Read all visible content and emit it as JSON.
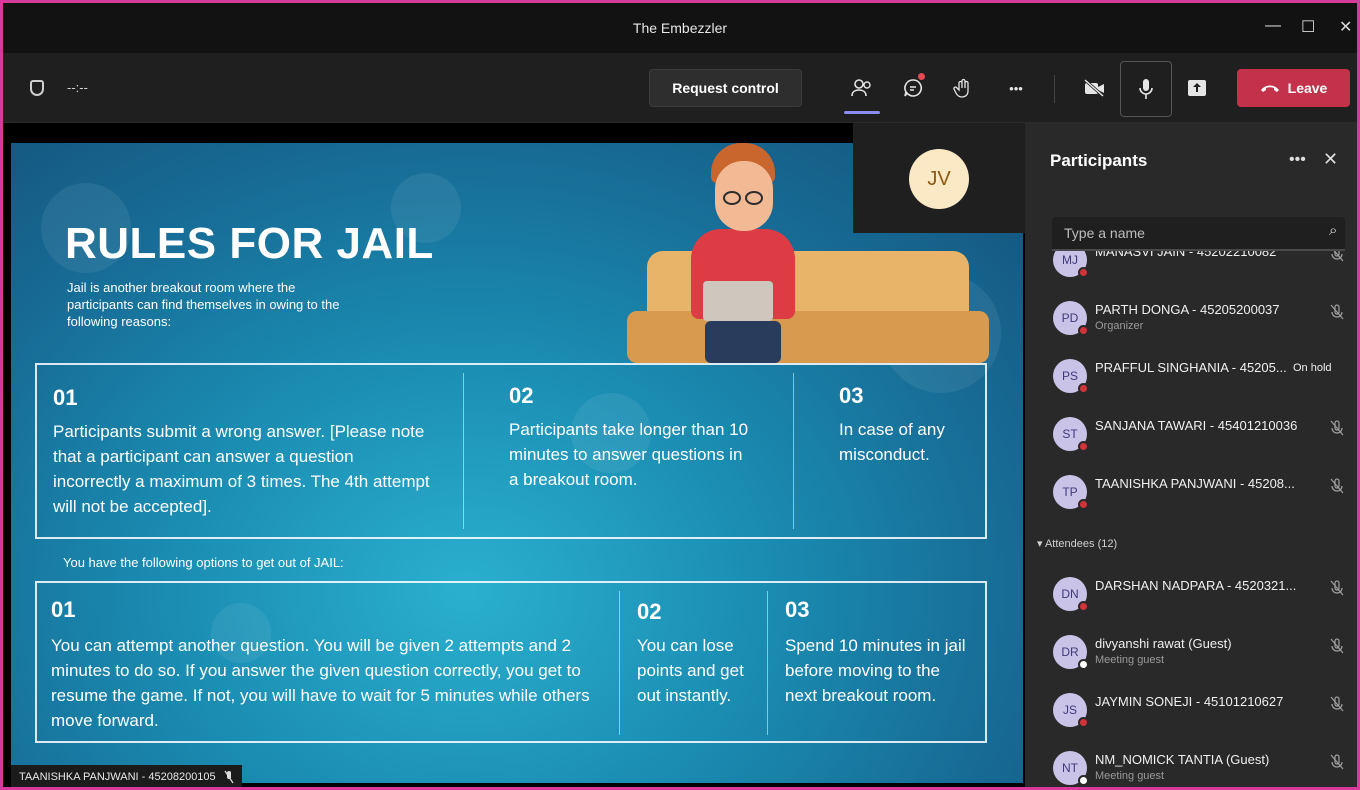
{
  "window": {
    "title": "The Embezzler",
    "minimize": "—",
    "maximize": "☐",
    "close": "✕"
  },
  "toolbar": {
    "timer": "--:--",
    "request_control": "Request control",
    "more": "•••",
    "leave": "Leave",
    "accent_color": "#c4314b"
  },
  "slide": {
    "title": "RULES FOR JAIL",
    "intro": "Jail is another breakout room where the participants can find themselves in owing to the following reasons:",
    "reasons": [
      {
        "num": "01",
        "text": "Participants submit a wrong answer. [Please note that a participant can answer a question incorrectly a maximum of 3 times. The 4th attempt will not be accepted]."
      },
      {
        "num": "02",
        "text": "Participants take longer than 10 minutes to answer questions in a breakout room."
      },
      {
        "num": "03",
        "text": "In case of any misconduct."
      }
    ],
    "options_label": "You have the following options to get out of JAIL:",
    "options": [
      {
        "num": "01",
        "text": "You can attempt another question. You will be given 2 attempts and 2 minutes to do so. If you answer the given question correctly, you get to resume the game. If not, you will have to wait for 5 minutes while others move forward."
      },
      {
        "num": "02",
        "text": "You can lose points and get out instantly."
      },
      {
        "num": "03",
        "text": "Spend 10 minutes in jail before moving to the next breakout room."
      }
    ]
  },
  "self_tile": {
    "initials": "JV"
  },
  "presenter": {
    "name": "TAANISHKA PANJWANI - 45208200105"
  },
  "participants_panel": {
    "title": "Participants",
    "more": "•••",
    "close": "✕",
    "search_placeholder": "Type a name",
    "presenters": [
      {
        "initials": "MJ",
        "name": "MANASVI JAIN - 45202210082",
        "role": "",
        "status": "red",
        "mic": "muted"
      },
      {
        "initials": "PD",
        "name": "PARTH DONGA - 45205200037",
        "role": "Organizer",
        "status": "red",
        "mic": "muted"
      },
      {
        "initials": "PS",
        "name": "PRAFFUL SINGHANIA - 45205...",
        "role": "",
        "status": "red",
        "mic": "hold",
        "hold": "On hold"
      },
      {
        "initials": "ST",
        "name": "SANJANA TAWARI - 45401210036",
        "role": "",
        "status": "red",
        "mic": "muted"
      },
      {
        "initials": "TP",
        "name": "TAANISHKA PANJWANI - 45208...",
        "role": "",
        "status": "red",
        "mic": "muted"
      }
    ],
    "attendees_label": "Attendees (12)",
    "attendees": [
      {
        "initials": "DN",
        "name": "DARSHAN NADPARA - 4520321...",
        "role": "",
        "status": "red",
        "mic": "muted"
      },
      {
        "initials": "DR",
        "name": "divyanshi rawat (Guest)",
        "role": "Meeting guest",
        "status": "white",
        "mic": "muted"
      },
      {
        "initials": "JS",
        "name": "JAYMIN SONEJI - 45101210627",
        "role": "",
        "status": "red",
        "mic": "muted"
      },
      {
        "initials": "NT",
        "name": "NM_NOMICK TANTIA (Guest)",
        "role": "Meeting guest",
        "status": "white",
        "mic": "muted"
      }
    ]
  }
}
